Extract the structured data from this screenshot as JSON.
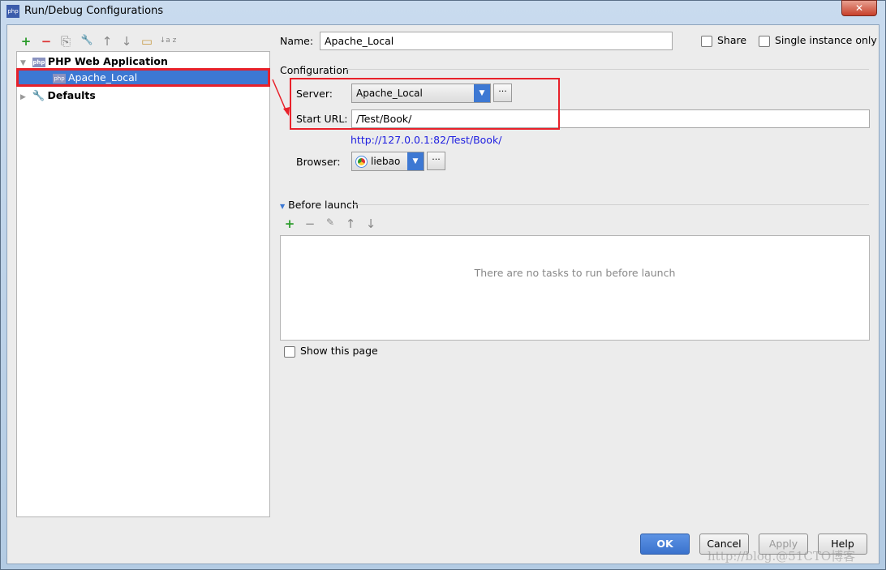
{
  "window": {
    "title": "Run/Debug Configurations",
    "close": "✕"
  },
  "toolbar": [
    "+",
    "−",
    "⎘",
    "🔧",
    "↑",
    "↓",
    "▭",
    "↓a z"
  ],
  "tree": {
    "group": "PHP Web Application",
    "item": "Apache_Local",
    "defaults": "Defaults"
  },
  "name": {
    "label": "Name:",
    "value": "Apache_Local"
  },
  "share": "Share",
  "single": "Single instance only",
  "configuration": "Configuration",
  "server": {
    "label": "Server:",
    "value": "Apache_Local"
  },
  "start_url": {
    "label": "Start URL:",
    "value": "/Test/Book/"
  },
  "link": "http://127.0.0.1:82/Test/Book/",
  "browser": {
    "label": "Browser:",
    "value": "liebao"
  },
  "before_launch": {
    "title": "Before launch",
    "empty": "There are no tasks to run before launch"
  },
  "show_page": "Show this page",
  "buttons": {
    "ok": "OK",
    "cancel": "Cancel",
    "apply": "Apply",
    "help": "Help"
  },
  "watermark": "http://blog.@51CTO博客",
  "colors": {
    "accent": "#3d78d3",
    "highlight": "#e8212a",
    "link": "#2020e0"
  }
}
